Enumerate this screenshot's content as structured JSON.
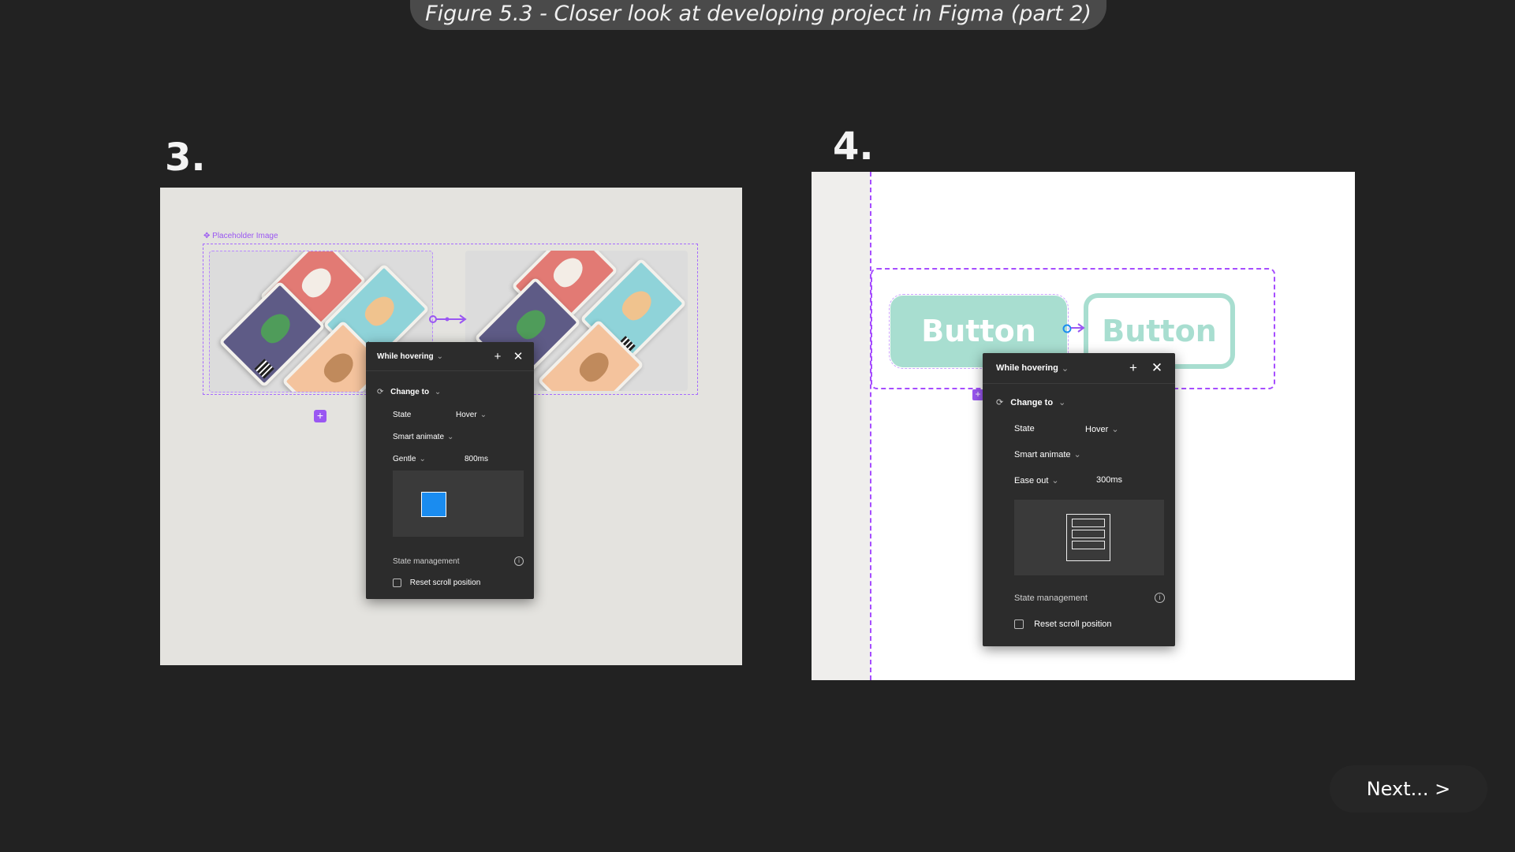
{
  "caption": "Figure 5.3 - Closer look at developing project in Figma (part 2)",
  "step3": {
    "number": "3.",
    "placeholder_label": "✥ Placeholder Image",
    "popover": {
      "trigger": "While hovering",
      "action": "Change to",
      "state_label": "State",
      "state_value": "Hover",
      "animation": "Smart animate",
      "easing": "Gentle",
      "duration": "800ms",
      "state_management": "State management",
      "reset_scroll": "Reset scroll position"
    }
  },
  "step4": {
    "number": "4.",
    "button_default_label": "Button",
    "button_hover_label": "Button",
    "popover": {
      "trigger": "While hovering",
      "action": "Change to",
      "state_label": "State",
      "state_value": "Hover",
      "animation": "Smart animate",
      "easing": "Ease out",
      "duration": "300ms",
      "state_management": "State management",
      "reset_scroll": "Reset scroll position"
    }
  },
  "next_label": "Next... >",
  "colors": {
    "background": "#222222",
    "accent_purple": "#9a57f2",
    "mint": "#a8ded0",
    "preview_blue": "#1a8cf0"
  }
}
